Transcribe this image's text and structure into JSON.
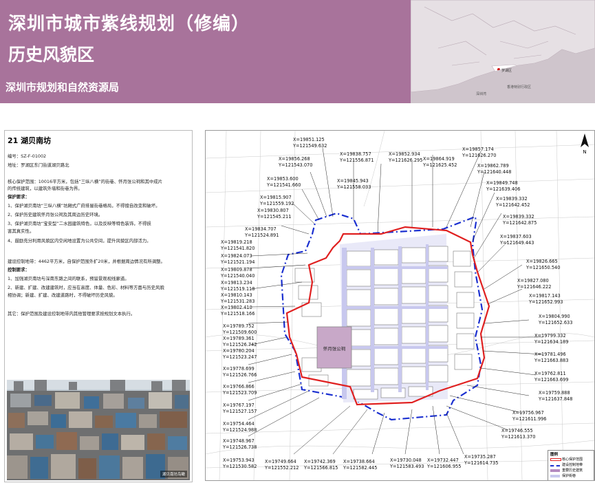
{
  "banner": {
    "title_line1": "深圳市城市紫线规划（修编）",
    "title_line2": "历史风貌区",
    "org": "深圳市规划和自然资源局",
    "bg_color": "#a8739b"
  },
  "left": {
    "heading": "21 湖贝南坊",
    "lines": [
      {
        "t": "编号：SZ-F-01002"
      },
      {
        "t": "地址：罗湖区东门街道湖贝路北"
      },
      {
        "t": "核心保护范围：10016平方米，包括“三纵八横”的街巷、怀月张公祠和其中成片"
      },
      {
        "t": "的传统建筑，以建筑外墙和街巷为界。"
      },
      {
        "t": "保护要求："
      },
      {
        "t": "1、保护湖贝南坊“三纵八横”坊厢式广府排屋街巷格局，不得擅自改变和破坏。"
      },
      {
        "t": "2、保护历史建筑怀月张公祠及其周边历史环境。"
      },
      {
        "t": "3、保护湖贝南坊“宝安型”二水园建筑特色，以及反映等特色装饰，不得损"
      },
      {
        "t": "害其真实性。"
      },
      {
        "t": "4、鼓励充分利用风貌区内空闲地设置为公共空间，提升风貌区内部活力。"
      },
      {
        "t": "建设控制地带：4462平方米，自保护范围外扩20米，并根据周边情况有所调整。"
      },
      {
        "t": "控制要求："
      },
      {
        "t": "1、加强湖贝南坊与深南东路之间的联系，预留景观视线廊道。"
      },
      {
        "t": "2、新建、扩建、改建建筑时，应当在高度、体量、色彩、材料等方面与历史风貌"
      },
      {
        "t": "相协调；新建、扩建、改建道路时，不得破坏历史风貌。"
      },
      {
        "t": "其它：保护范围及建设控制地带内其他管理要求按规划文本执行。"
      }
    ],
    "photo_caption": "湖贝南坊鸟瞰"
  },
  "map": {
    "building_label": "怀月张公祠",
    "coords": [
      "X=19851.125",
      "Y=121549.632",
      "X=19856.268",
      "Y=121543.070",
      "X=19838.757",
      "Y=121556.871",
      "X=19852.934",
      "Y=121626.295",
      "X=19864.919",
      "Y=121625.452",
      "X=19857.174",
      "Y=121626.270",
      "X=19862.789",
      "Y=121640.448",
      "X=19849.748",
      "Y=121639.406",
      "X=19839.332",
      "Y=121642.452",
      "X=19853.600",
      "Y=121541.660",
      "X=19845.943",
      "Y=121558.033",
      "X=19815.907",
      "Y=121559.192",
      "X=19830.807",
      "Y=121545.211",
      "X=19834.707",
      "Y=121524.891",
      "X=19839.332",
      "Y=121642.875",
      "X=19837.603",
      "Y=121649.443",
      "X=19819.218",
      "Y=121541.820",
      "X=19824.073",
      "Y=121521.194",
      "X=19809.878",
      "Y=121540.040",
      "X=19813.234",
      "Y=121519.118",
      "X=19810.143",
      "Y=121531.283",
      "X=19802.410",
      "Y=121518.166",
      "X=19826.665",
      "Y=121650.540",
      "X=19827.080",
      "Y=121646.222",
      "X=19817.143",
      "Y=121652.993",
      "X=19804.990",
      "Y=121652.633",
      "X=19789.752",
      "Y=121509.600",
      "X=19789.361",
      "Y=121526.742",
      "X=19780.204",
      "Y=121523.247",
      "X=19778.699",
      "Y=121526.766",
      "X=19766.866",
      "Y=121523.709",
      "X=19767.197",
      "Y=121527.157",
      "X=19754.464",
      "Y=121524.988",
      "X=19748.967",
      "Y=121526.738",
      "X=19753.943",
      "Y=121530.582",
      "X=19799.332",
      "Y=121634.189",
      "X=19781.496",
      "Y=121663.883",
      "X=19762.811",
      "Y=121663.699",
      "X=19759.888",
      "Y=121637.848",
      "X=19756.967",
      "Y=121611.996",
      "X=19746.555",
      "Y=121613.370",
      "X=19749.664",
      "Y=121552.212",
      "X=19742.369",
      "Y=121566.815",
      "X=19738.664",
      "Y=121582.445",
      "X=19730.048",
      "Y=121583.493",
      "X=19732.447",
      "Y=121606.955",
      "X=19735.287",
      "Y=121614.735"
    ],
    "legend": {
      "title": "图例",
      "items": [
        {
          "label": "核心保护范围",
          "color": "#e02020"
        },
        {
          "label": "建设控制地带",
          "color": "#1a2fd0"
        },
        {
          "label": "重要历史建筑",
          "color": "#b48ac0"
        },
        {
          "label": "保护街巷",
          "color": "#c8c8ee"
        }
      ]
    }
  },
  "minimap": {
    "labels": [
      "罗湖区",
      "深圳湾",
      "香港特别行政区"
    ]
  }
}
